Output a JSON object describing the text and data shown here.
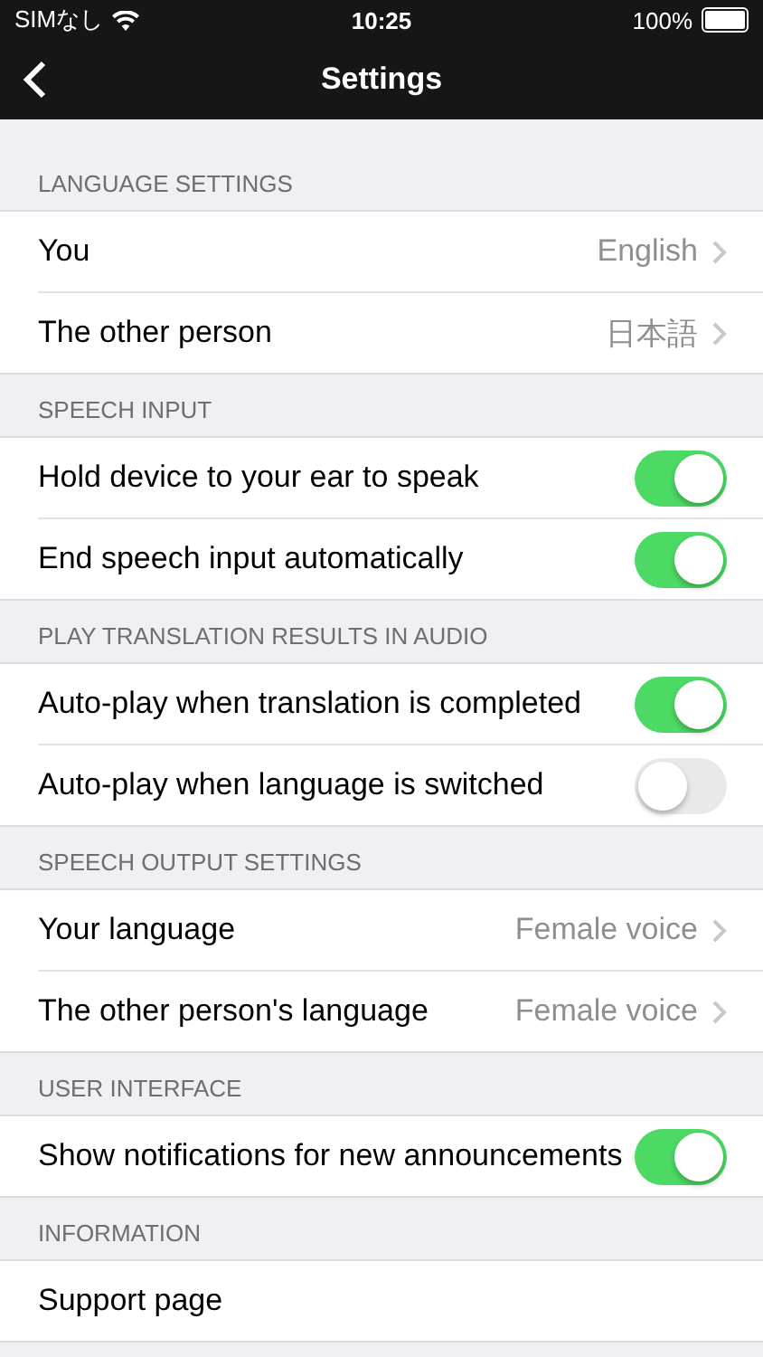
{
  "status_bar": {
    "carrier": "SIMなし",
    "time": "10:25",
    "battery": "100%"
  },
  "nav_bar": {
    "title": "Settings"
  },
  "sections": [
    {
      "header": "LANGUAGE SETTINGS",
      "rows": [
        {
          "kind": "value",
          "label": "You",
          "value": "English"
        },
        {
          "kind": "value",
          "label": "The other person",
          "value": "日本語"
        }
      ]
    },
    {
      "header": "SPEECH INPUT",
      "rows": [
        {
          "kind": "toggle",
          "label": "Hold device to your ear to speak",
          "on": true
        },
        {
          "kind": "toggle",
          "label": "End speech input automatically",
          "on": true
        }
      ]
    },
    {
      "header": "PLAY TRANSLATION RESULTS IN AUDIO",
      "rows": [
        {
          "kind": "toggle",
          "label": "Auto-play when translation is completed",
          "on": true
        },
        {
          "kind": "toggle",
          "label": "Auto-play when language is switched",
          "on": false
        }
      ]
    },
    {
      "header": "SPEECH OUTPUT SETTINGS",
      "rows": [
        {
          "kind": "value",
          "label": "Your language",
          "value": "Female voice"
        },
        {
          "kind": "value",
          "label": "The other person's language",
          "value": "Female voice"
        }
      ]
    },
    {
      "header": "USER INTERFACE",
      "rows": [
        {
          "kind": "toggle",
          "label": "Show notifications for new announcements",
          "on": true
        }
      ]
    },
    {
      "header": "INFORMATION",
      "rows": [
        {
          "kind": "link",
          "label": "Support page"
        }
      ]
    }
  ]
}
